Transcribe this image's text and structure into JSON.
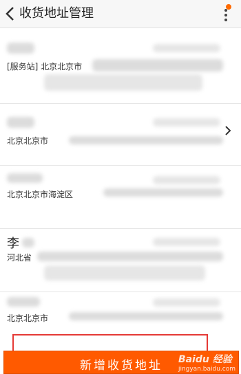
{
  "header": {
    "title": "收货地址管理"
  },
  "addresses": [
    {
      "name": "",
      "address": "[服务站] 北京北京市"
    },
    {
      "name": "",
      "address": "北京北京市"
    },
    {
      "name": "",
      "address": "北京北京市海淀区"
    },
    {
      "name": "李",
      "address": "河北省"
    },
    {
      "name": "",
      "address": "北京北京市"
    }
  ],
  "footer": {
    "add_button_label": "新增收货地址"
  },
  "watermark": {
    "brand": "Baidu 经验",
    "url": "jingyan.baidu.com"
  },
  "colors": {
    "accent": "#ff5a00",
    "highlight_border": "#e53935",
    "notification_dot": "#ff6a00"
  }
}
